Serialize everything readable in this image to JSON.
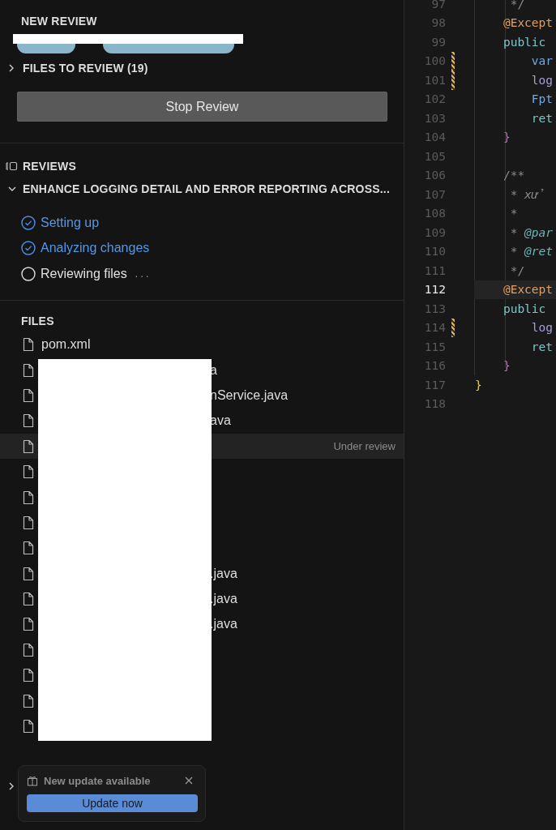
{
  "new_review": {
    "title": "NEW REVIEW",
    "branches": {
      "redacted": true
    },
    "files_to_review": {
      "label": "FILES TO REVIEW (19)",
      "expanded": false
    },
    "stop_button": "Stop Review"
  },
  "reviews": {
    "title": "REVIEWS",
    "review": {
      "title": "ENHANCE LOGGING DETAIL AND ERROR REPORTING ACROSS...",
      "expanded": true
    },
    "steps": [
      {
        "label": "Setting up",
        "done": true
      },
      {
        "label": "Analyzing changes",
        "done": true
      },
      {
        "label": "Reviewing files",
        "done": false,
        "suffix": ". . ."
      }
    ]
  },
  "files": {
    "title": "FILES",
    "items": [
      {
        "name": "pom.xml",
        "redacted": false,
        "active": false
      },
      {
        "name": "a",
        "redacted": true,
        "active": false
      },
      {
        "name": "nService.java",
        "redacted": true,
        "active": false
      },
      {
        "name": "ava",
        "redacted": true,
        "active": false
      },
      {
        "redacted": true,
        "active": true,
        "status": "Under review"
      },
      {
        "redacted": true,
        "active": false
      },
      {
        "redacted": true,
        "active": false
      },
      {
        "redacted": true,
        "active": false
      },
      {
        "redacted": true,
        "active": false
      },
      {
        "name": ".java",
        "redacted": true,
        "active": false
      },
      {
        "name": ".java",
        "redacted": true,
        "active": false
      },
      {
        "name": ".java",
        "redacted": true,
        "active": false
      },
      {
        "redacted": true,
        "active": false
      },
      {
        "redacted": true,
        "active": false
      },
      {
        "redacted": true,
        "active": false
      },
      {
        "redacted": true,
        "active": false
      }
    ]
  },
  "collapsed_section": {
    "expanded": false
  },
  "update_toast": {
    "title": "New update available",
    "button": "Update now"
  },
  "editor": {
    "lines": [
      {
        "number": "97",
        "current": false,
        "modified": false,
        "code": [
          {
            "text": "     */",
            "kind": "comment"
          }
        ]
      },
      {
        "number": "98",
        "current": false,
        "modified": false,
        "code": [
          {
            "text": "    @Except",
            "kind": "annotation"
          }
        ]
      },
      {
        "number": "99",
        "current": false,
        "modified": false,
        "code": [
          {
            "text": "    public",
            "kind": "keyword"
          }
        ]
      },
      {
        "number": "100",
        "current": false,
        "modified": true,
        "code": [
          {
            "text": "        var",
            "kind": "type"
          }
        ]
      },
      {
        "number": "101",
        "current": false,
        "modified": true,
        "code": [
          {
            "text": "        log",
            "kind": "field"
          }
        ]
      },
      {
        "number": "102",
        "current": false,
        "modified": false,
        "code": [
          {
            "text": "        Fpt",
            "kind": "type"
          }
        ]
      },
      {
        "number": "103",
        "current": false,
        "modified": false,
        "code": [
          {
            "text": "        ret",
            "kind": "keyword"
          }
        ]
      },
      {
        "number": "104",
        "current": false,
        "modified": false,
        "code": [
          {
            "text": "    }",
            "kind": "brace"
          }
        ]
      },
      {
        "number": "105",
        "current": false,
        "modified": false
      },
      {
        "number": "106",
        "current": false,
        "modified": false,
        "code": [
          {
            "text": "    /**",
            "kind": "comment"
          }
        ]
      },
      {
        "number": "107",
        "current": false,
        "modified": false,
        "code": [
          {
            "text": "     * ",
            "kind": "comment"
          },
          {
            "text": "xử",
            "kind": "doc"
          }
        ]
      },
      {
        "number": "108",
        "current": false,
        "modified": false,
        "code": [
          {
            "text": "     *",
            "kind": "comment"
          }
        ]
      },
      {
        "number": "109",
        "current": false,
        "modified": false,
        "code": [
          {
            "text": "     * ",
            "kind": "comment"
          },
          {
            "text": "@par",
            "kind": "doctag"
          }
        ]
      },
      {
        "number": "110",
        "current": false,
        "modified": false,
        "code": [
          {
            "text": "     * ",
            "kind": "comment"
          },
          {
            "text": "@ret",
            "kind": "doctag"
          }
        ]
      },
      {
        "number": "111",
        "current": false,
        "modified": false,
        "code": [
          {
            "text": "     */",
            "kind": "comment"
          }
        ]
      },
      {
        "number": "112",
        "current": true,
        "modified": false,
        "code": [
          {
            "text": "    @Except",
            "kind": "annotation"
          }
        ]
      },
      {
        "number": "113",
        "current": false,
        "modified": false,
        "code": [
          {
            "text": "    public",
            "kind": "keyword"
          }
        ]
      },
      {
        "number": "114",
        "current": false,
        "modified": true,
        "code": [
          {
            "text": "        log",
            "kind": "field"
          }
        ]
      },
      {
        "number": "115",
        "current": false,
        "modified": false,
        "code": [
          {
            "text": "        ret",
            "kind": "keyword"
          }
        ]
      },
      {
        "number": "116",
        "current": false,
        "modified": false,
        "code": [
          {
            "text": "    }",
            "kind": "brace"
          }
        ]
      },
      {
        "number": "117",
        "current": false,
        "modified": false,
        "code": [
          {
            "text": "}",
            "kind": "classbrace"
          }
        ]
      },
      {
        "number": "118",
        "current": false,
        "modified": false
      }
    ]
  }
}
